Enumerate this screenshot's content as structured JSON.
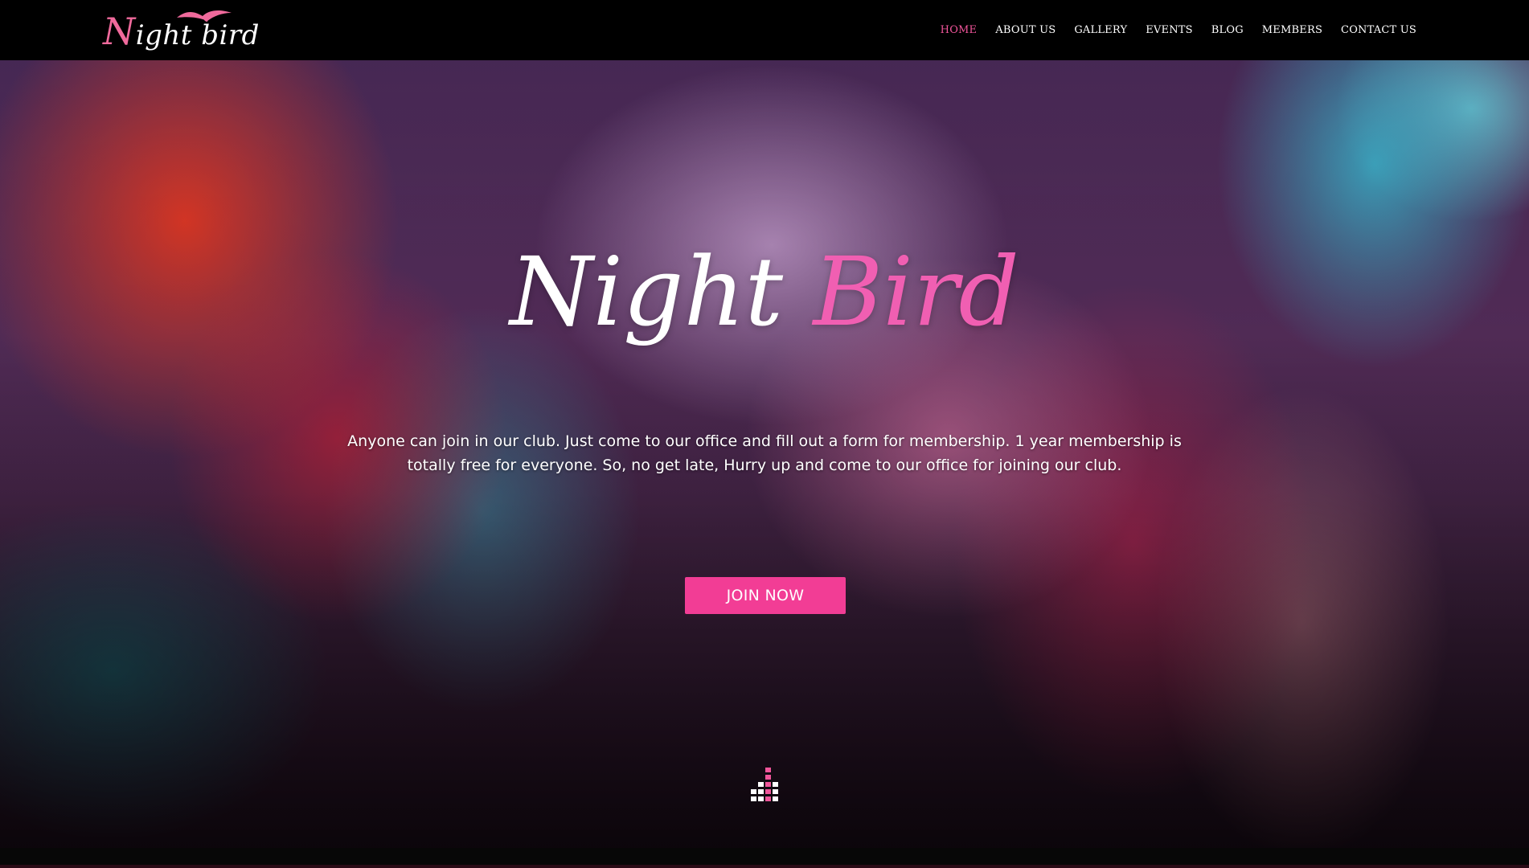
{
  "brand": {
    "logo_first": "N",
    "logo_rest": "ight bird",
    "logo_color": "#f06a9c"
  },
  "nav": {
    "items": [
      {
        "label": "HOME",
        "active": true
      },
      {
        "label": "ABOUT US",
        "active": false
      },
      {
        "label": "GALLERY",
        "active": false
      },
      {
        "label": "EVENTS",
        "active": false
      },
      {
        "label": "BLOG",
        "active": false
      },
      {
        "label": "MEMBERS",
        "active": false
      },
      {
        "label": "CONTACT US",
        "active": false
      }
    ],
    "active_color": "#f0559a"
  },
  "hero": {
    "title_part1": "Night ",
    "title_part2": "Bird",
    "description": "Anyone can join in our club. Just come to our office and fill out a form for membership. 1 year membership is totally free for everyone. So, no get late, Hurry up and come to our office for joining our club.",
    "cta_label": "JOIN NOW",
    "accent_color": "#f23d95",
    "scroll_icon": "equalizer-icon"
  }
}
